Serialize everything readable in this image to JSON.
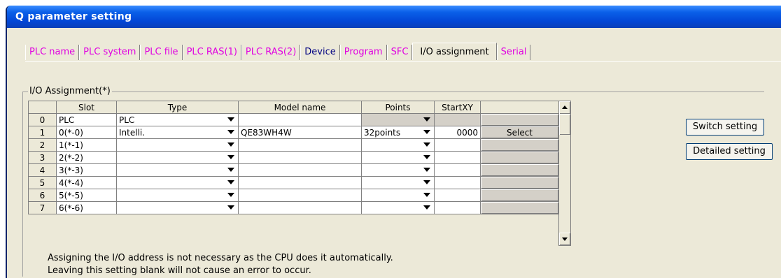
{
  "window": {
    "title": "Q parameter setting"
  },
  "tabs": [
    {
      "label": "PLC name",
      "state": "normal"
    },
    {
      "label": "PLC system",
      "state": "normal"
    },
    {
      "label": "PLC file",
      "state": "normal"
    },
    {
      "label": "PLC RAS(1)",
      "state": "normal"
    },
    {
      "label": "PLC RAS(2)",
      "state": "normal"
    },
    {
      "label": "Device",
      "state": "default"
    },
    {
      "label": "Program",
      "state": "normal"
    },
    {
      "label": "SFC",
      "state": "normal"
    },
    {
      "label": "I/O assignment",
      "state": "active"
    },
    {
      "label": "Serial",
      "state": "normal"
    }
  ],
  "group": {
    "legend": "I/O Assignment(*)"
  },
  "table": {
    "headers": [
      "",
      "Slot",
      "Type",
      "Model name",
      "Points",
      "StartXY",
      ""
    ],
    "rows": [
      {
        "num": "0",
        "slot": "PLC",
        "type": "PLC",
        "model": "",
        "points": "",
        "startxy": "",
        "select": ""
      },
      {
        "num": "1",
        "slot": "0(*-0)",
        "type": "Intelli.",
        "model": "QE83WH4W",
        "points": "32points",
        "startxy": "0000",
        "select": "Select"
      },
      {
        "num": "2",
        "slot": "1(*-1)",
        "type": "",
        "model": "",
        "points": "",
        "startxy": "",
        "select": ""
      },
      {
        "num": "3",
        "slot": "2(*-2)",
        "type": "",
        "model": "",
        "points": "",
        "startxy": "",
        "select": ""
      },
      {
        "num": "4",
        "slot": "3(*-3)",
        "type": "",
        "model": "",
        "points": "",
        "startxy": "",
        "select": ""
      },
      {
        "num": "5",
        "slot": "4(*-4)",
        "type": "",
        "model": "",
        "points": "",
        "startxy": "",
        "select": ""
      },
      {
        "num": "6",
        "slot": "5(*-5)",
        "type": "",
        "model": "",
        "points": "",
        "startxy": "",
        "select": ""
      },
      {
        "num": "7",
        "slot": "6(*-6)",
        "type": "",
        "model": "",
        "points": "",
        "startxy": "",
        "select": ""
      }
    ]
  },
  "buttons": {
    "switch_setting": "Switch setting",
    "detailed_setting": "Detailed setting"
  },
  "notes": {
    "line1": "Assigning the I/O address is not necessary as the CPU does it automatically.",
    "line2": "Leaving this setting blank will not cause an error to occur."
  },
  "colors": {
    "tab_normal": "#e000e0",
    "tab_default": "#000080",
    "titlebar": "#0347d6",
    "dialog_bg": "#ece9d8"
  },
  "icons": [
    "dropdown-arrow-icon",
    "scroll-up-icon",
    "scroll-down-icon"
  ]
}
